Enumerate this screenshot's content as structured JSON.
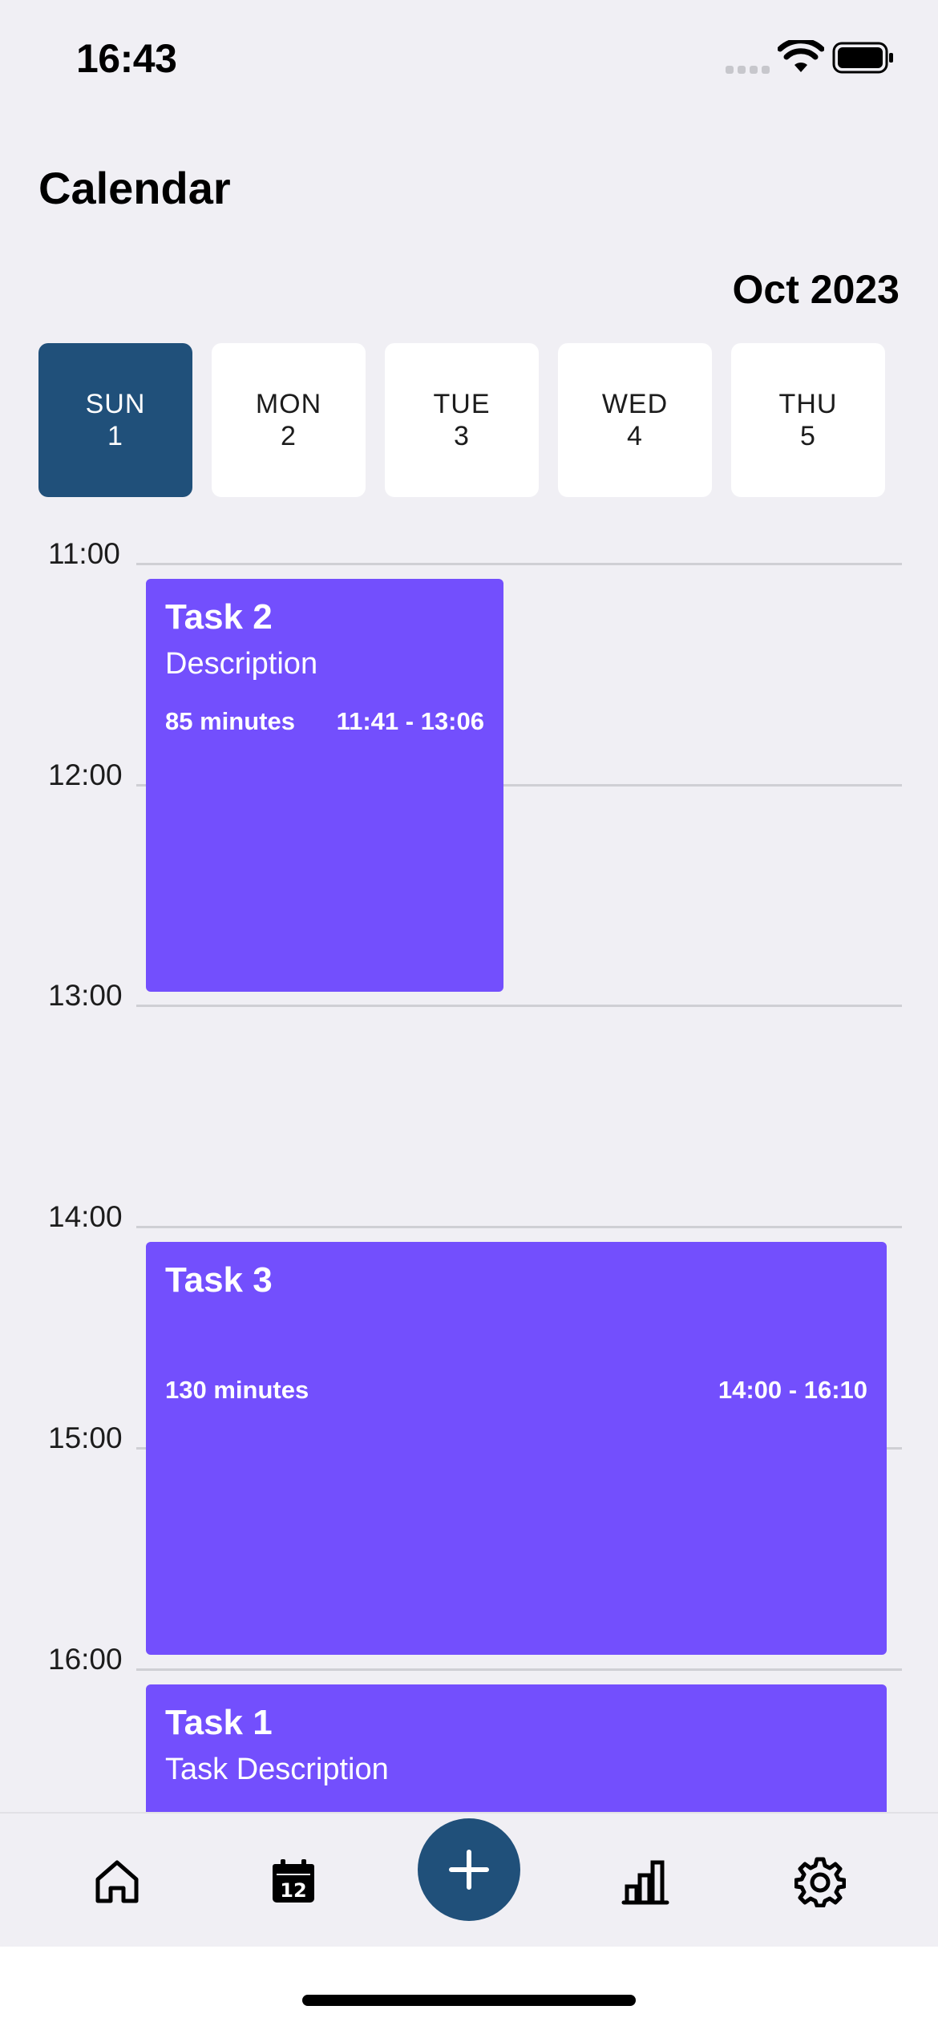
{
  "status_bar": {
    "time": "16:43"
  },
  "header": {
    "title": "Calendar",
    "month": "Oct 2023"
  },
  "days": [
    {
      "name": "SUN",
      "num": "1"
    },
    {
      "name": "MON",
      "num": "2"
    },
    {
      "name": "TUE",
      "num": "3"
    },
    {
      "name": "WED",
      "num": "4"
    },
    {
      "name": "THU",
      "num": "5"
    }
  ],
  "hours": [
    "11:00",
    "12:00",
    "13:00",
    "14:00",
    "15:00",
    "16:00"
  ],
  "tasks": [
    {
      "title": "Task 2",
      "description": "Description",
      "duration": "85 minutes",
      "range": "11:41 - 13:06"
    },
    {
      "title": "Task 3",
      "description": "",
      "duration": "130 minutes",
      "range": "14:00 - 16:10"
    },
    {
      "title": "Task 1",
      "description": "Task Description"
    }
  ],
  "colors": {
    "background": "#f0eff4",
    "accent": "#20507a",
    "task": "#734ffd"
  },
  "tab_bar": {
    "items": [
      {
        "icon": "home-icon"
      },
      {
        "icon": "calendar-icon",
        "badge": "12"
      },
      {
        "icon": "plus-icon"
      },
      {
        "icon": "bar-chart-icon"
      },
      {
        "icon": "gear-icon"
      }
    ]
  }
}
